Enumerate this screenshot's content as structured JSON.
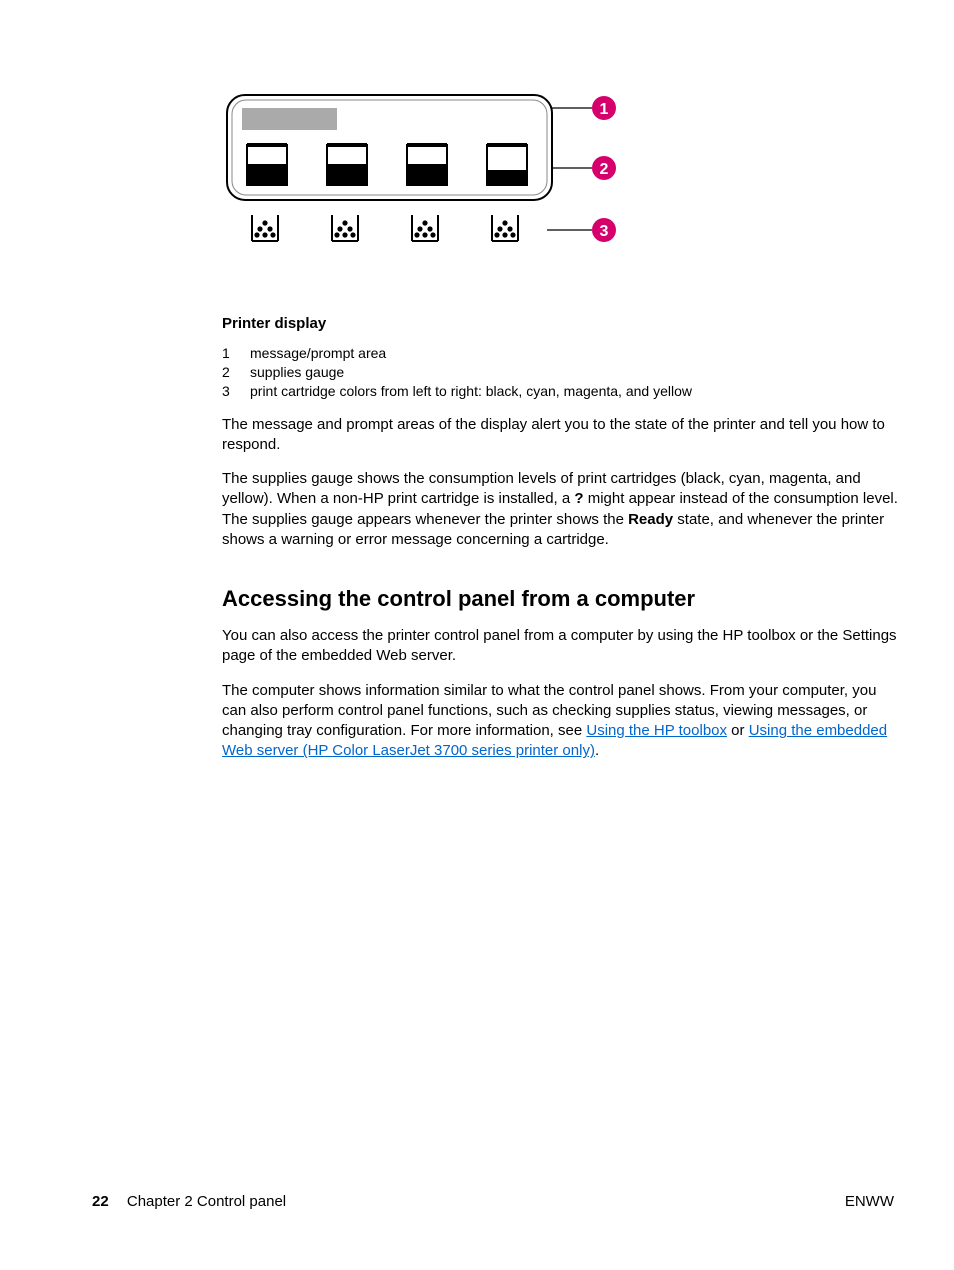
{
  "figure": {
    "callouts": [
      "1",
      "2",
      "3"
    ],
    "fill_levels": [
      0.55,
      0.55,
      0.55,
      0.4
    ]
  },
  "section_head": "Printer display",
  "legend": [
    {
      "n": "1",
      "t": "message/prompt area"
    },
    {
      "n": "2",
      "t": "supplies gauge"
    },
    {
      "n": "3",
      "t": "print cartridge colors from left to right: black, cyan, magenta, and yellow"
    }
  ],
  "para1": "The message and prompt areas of the display alert you to the state of the printer and tell you how to respond.",
  "para2_a": "The supplies gauge shows the consumption levels of print cartridges (black, cyan, magenta, and yellow). When a non-HP print cartridge is installed, a ",
  "para2_q": "?",
  "para2_b": " might appear instead of the consumption level. The supplies gauge appears whenever the printer shows the ",
  "para2_ready": "Ready",
  "para2_c": " state, and whenever the printer shows a warning or error message concerning a cartridge.",
  "heading2": "Accessing the control panel from a computer",
  "para3": "You can also access the printer control panel from a computer by using the HP toolbox or the Settings page of the embedded Web server.",
  "para4_a": "The computer shows information similar to what the control panel shows. From your computer, you can also perform control panel functions, such as checking supplies status, viewing messages, or changing tray configuration. For more information, see ",
  "link1": "Using the HP toolbox",
  "para4_b": " or ",
  "link2": "Using the embedded Web server (HP Color LaserJet 3700 series printer only)",
  "para4_c": ".",
  "footer": {
    "page_num": "22",
    "chapter": "Chapter 2   Control panel",
    "right": "ENWW"
  }
}
